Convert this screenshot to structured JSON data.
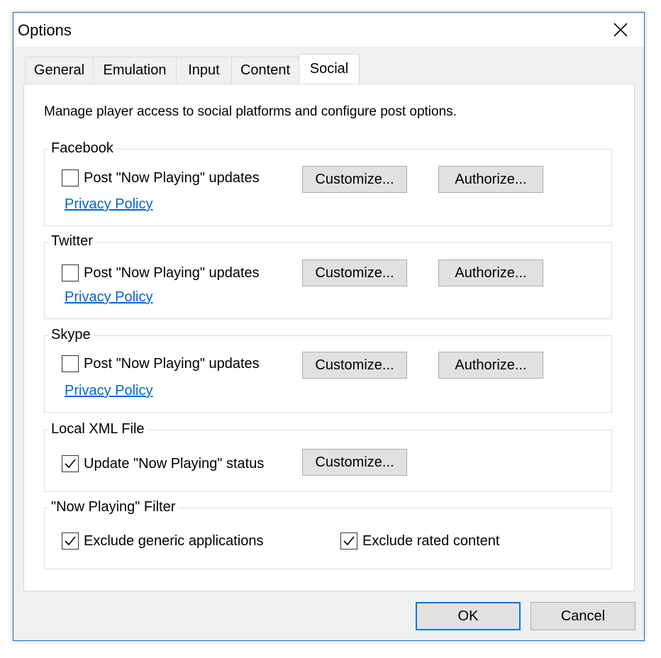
{
  "window": {
    "title": "Options"
  },
  "tabs": [
    {
      "label": "General"
    },
    {
      "label": "Emulation"
    },
    {
      "label": "Input"
    },
    {
      "label": "Content"
    },
    {
      "label": "Social",
      "active": true
    }
  ],
  "intro": "Manage player access to social platforms and configure post options.",
  "facebook": {
    "label": "Facebook",
    "post_label": "Post \"Now Playing\" updates",
    "post_checked": false,
    "customize": "Customize...",
    "authorize": "Authorize...",
    "privacy": "Privacy Policy"
  },
  "twitter": {
    "label": "Twitter",
    "post_label": "Post \"Now Playing\" updates",
    "post_checked": false,
    "customize": "Customize...",
    "authorize": "Authorize...",
    "privacy": "Privacy Policy"
  },
  "skype": {
    "label": "Skype",
    "post_label": "Post \"Now Playing\" updates",
    "post_checked": false,
    "customize": "Customize...",
    "authorize": "Authorize...",
    "privacy": "Privacy Policy"
  },
  "local_xml": {
    "label": "Local XML File",
    "update_label": "Update \"Now Playing\" status",
    "update_checked": true,
    "customize": "Customize..."
  },
  "filter": {
    "label": "\"Now Playing\" Filter",
    "exclude_generic": "Exclude generic applications",
    "exclude_generic_checked": true,
    "exclude_rated": "Exclude rated content",
    "exclude_rated_checked": true
  },
  "footer": {
    "ok": "OK",
    "cancel": "Cancel"
  },
  "colors": {
    "accent": "#0078d7",
    "link": "#0066cc",
    "window_border": "#1a73c9"
  }
}
